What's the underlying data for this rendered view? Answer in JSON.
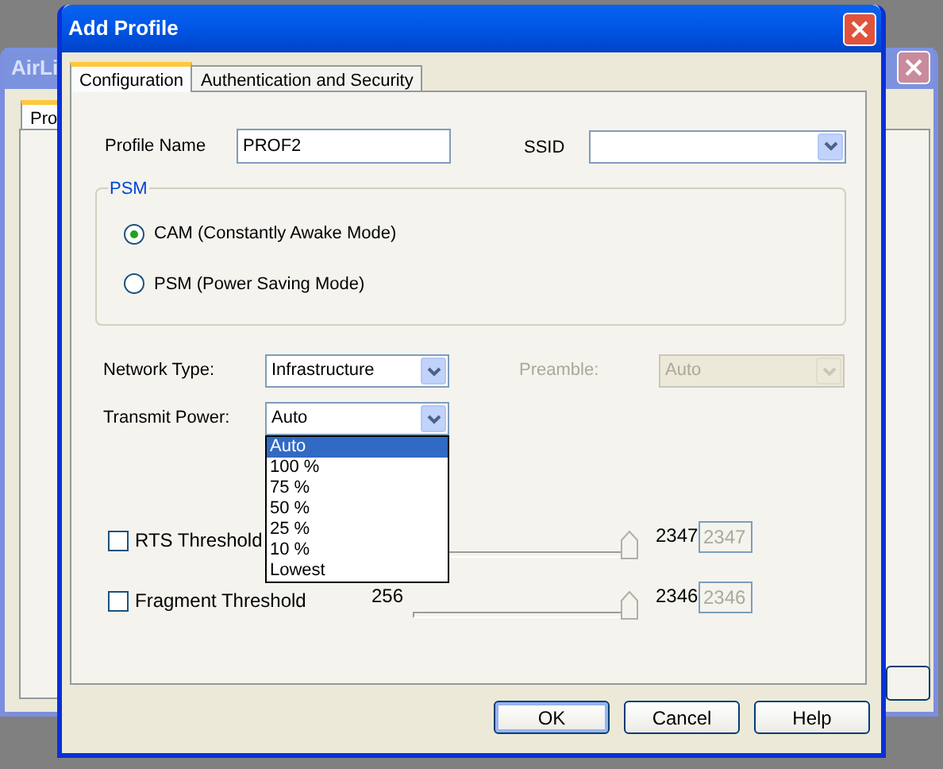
{
  "background_window": {
    "title": "AirLi",
    "tab": "Pro"
  },
  "dialog": {
    "title": "Add Profile"
  },
  "tabs": [
    {
      "label": "Configuration",
      "selected": true
    },
    {
      "label": "Authentication and Security",
      "selected": false
    }
  ],
  "profile_name": {
    "label": "Profile Name",
    "value": "PROF2"
  },
  "ssid": {
    "label": "SSID"
  },
  "psm": {
    "title": "PSM",
    "options": [
      {
        "label": "CAM (Constantly Awake Mode)",
        "selected": true
      },
      {
        "label": "PSM (Power Saving Mode)",
        "selected": false
      }
    ]
  },
  "network_type": {
    "label": "Network Type:",
    "value": "Infrastructure",
    "disabled": false
  },
  "preamble": {
    "label": "Preamble:",
    "value": "Auto",
    "disabled": true
  },
  "transmit_power": {
    "label": "Transmit Power:",
    "value": "Auto",
    "expanded": true,
    "options": [
      {
        "label": "Auto",
        "selected": true
      },
      {
        "label": "100 %",
        "selected": false
      },
      {
        "label": "75 %",
        "selected": false
      },
      {
        "label": "50 %",
        "selected": false
      },
      {
        "label": "25 %",
        "selected": false
      },
      {
        "label": "10 %",
        "selected": false
      },
      {
        "label": "Lowest",
        "selected": false
      }
    ]
  },
  "thresholds": [
    {
      "label": "RTS Threshold",
      "checked": false,
      "level": 1,
      "reading": "2347",
      "value": "2347",
      "disabled": true
    },
    {
      "label": "Fragment Threshold",
      "checked": false,
      "min": "256",
      "level": 1,
      "reading": "2346",
      "value": "2346",
      "disabled": true
    }
  ],
  "buttons": [
    {
      "label": "OK",
      "default": true
    },
    {
      "label": "Cancel",
      "default": false
    },
    {
      "label": "Help",
      "default": false
    }
  ]
}
